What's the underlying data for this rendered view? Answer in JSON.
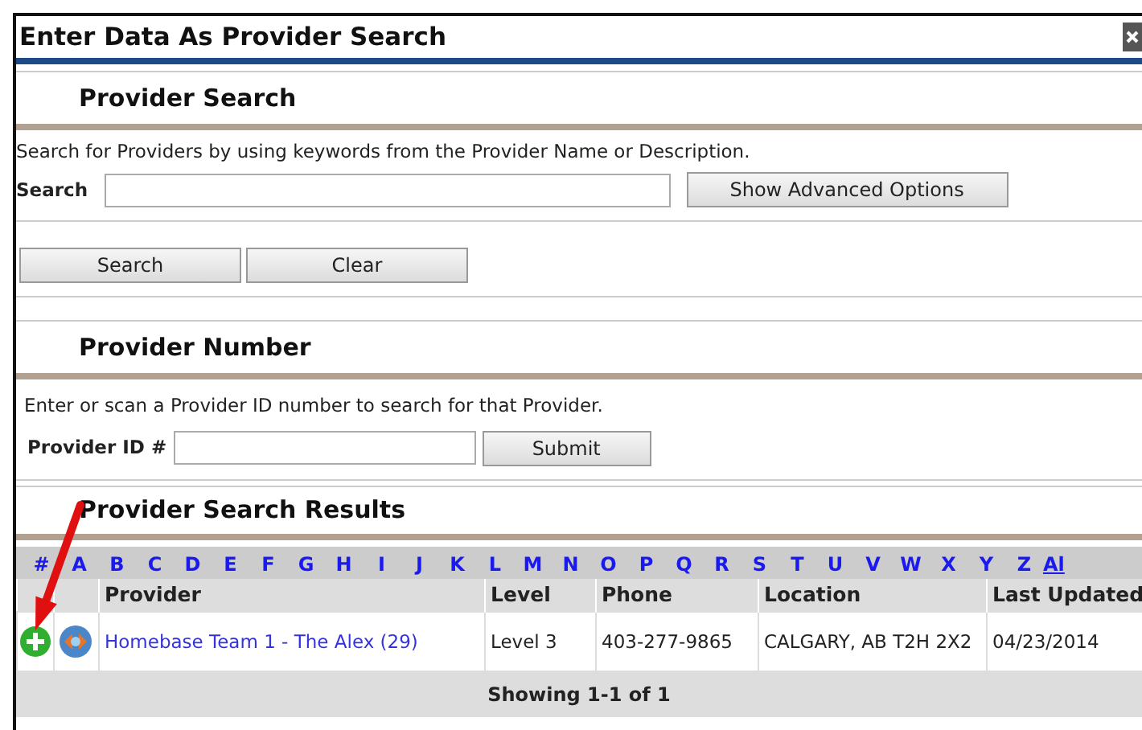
{
  "window": {
    "title": "Enter Data As Provider Search"
  },
  "provider_search": {
    "heading": "Provider Search",
    "description": "Search for Providers by using keywords from the Provider Name or Description.",
    "search_label": "Search",
    "advanced_button": "Show Advanced Options",
    "buttons": [
      "Search",
      "Clear"
    ]
  },
  "provider_number": {
    "heading": "Provider Number",
    "description": "Enter or scan a Provider ID number to search for that Provider.",
    "id_label": "Provider ID #",
    "submit_button": "Submit"
  },
  "results": {
    "heading": "Provider Search Results",
    "letters": [
      "#",
      "A",
      "B",
      "C",
      "D",
      "E",
      "F",
      "G",
      "H",
      "I",
      "J",
      "K",
      "L",
      "M",
      "N",
      "O",
      "P",
      "Q",
      "R",
      "S",
      "T",
      "U",
      "V",
      "W",
      "X",
      "Y",
      "Z",
      "Al"
    ],
    "columns": [
      "Provider",
      "Level",
      "Phone",
      "Location",
      "Last Updated"
    ],
    "rows": [
      {
        "provider": "Homebase Team 1 - The Alex (29)",
        "level": "Level 3",
        "phone": "403-277-9865",
        "location": "CALGARY, AB T2H 2X2",
        "last_updated": "04/23/2014"
      }
    ],
    "footer": "Showing 1-1 of 1"
  }
}
